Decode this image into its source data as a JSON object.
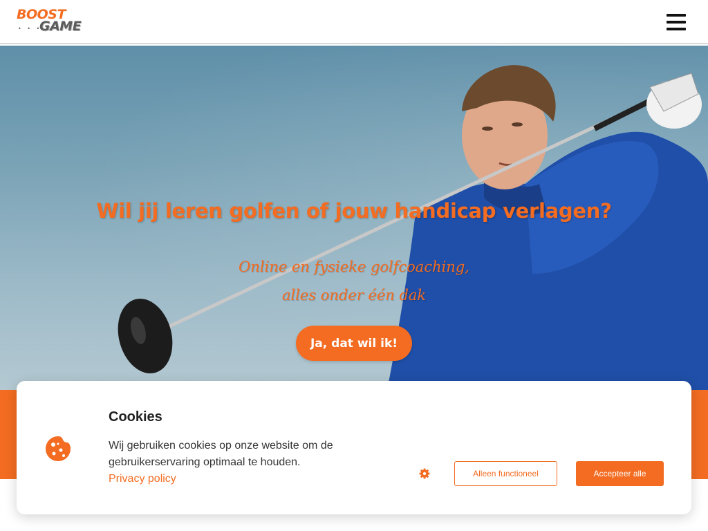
{
  "header": {
    "logo_line1": "BOOST",
    "logo_line2": "GAME",
    "logo_dots": "• • • •",
    "menu_icon": "hamburger-menu-icon"
  },
  "hero": {
    "title": "Wil jij leren golfen of jouw handicap verlagen?",
    "subtitle_line1": "Online en fysieke golfcoaching,",
    "subtitle_line2": "alles onder één dak",
    "cta_label": "Ja, dat wil ik!"
  },
  "cookie_banner": {
    "icon": "cookie-icon",
    "title": "Cookies",
    "text": "Wij gebruiken cookies op onze website om de gebruikerservaring optimaal te houden.",
    "privacy_link": "Privacy policy",
    "settings_icon": "gear-icon",
    "functional_label": "Alleen functioneel",
    "accept_label": "Accepteer alle"
  },
  "colors": {
    "accent": "#f36c21",
    "header_bg": "#ffffff",
    "text_dark": "#222222"
  }
}
